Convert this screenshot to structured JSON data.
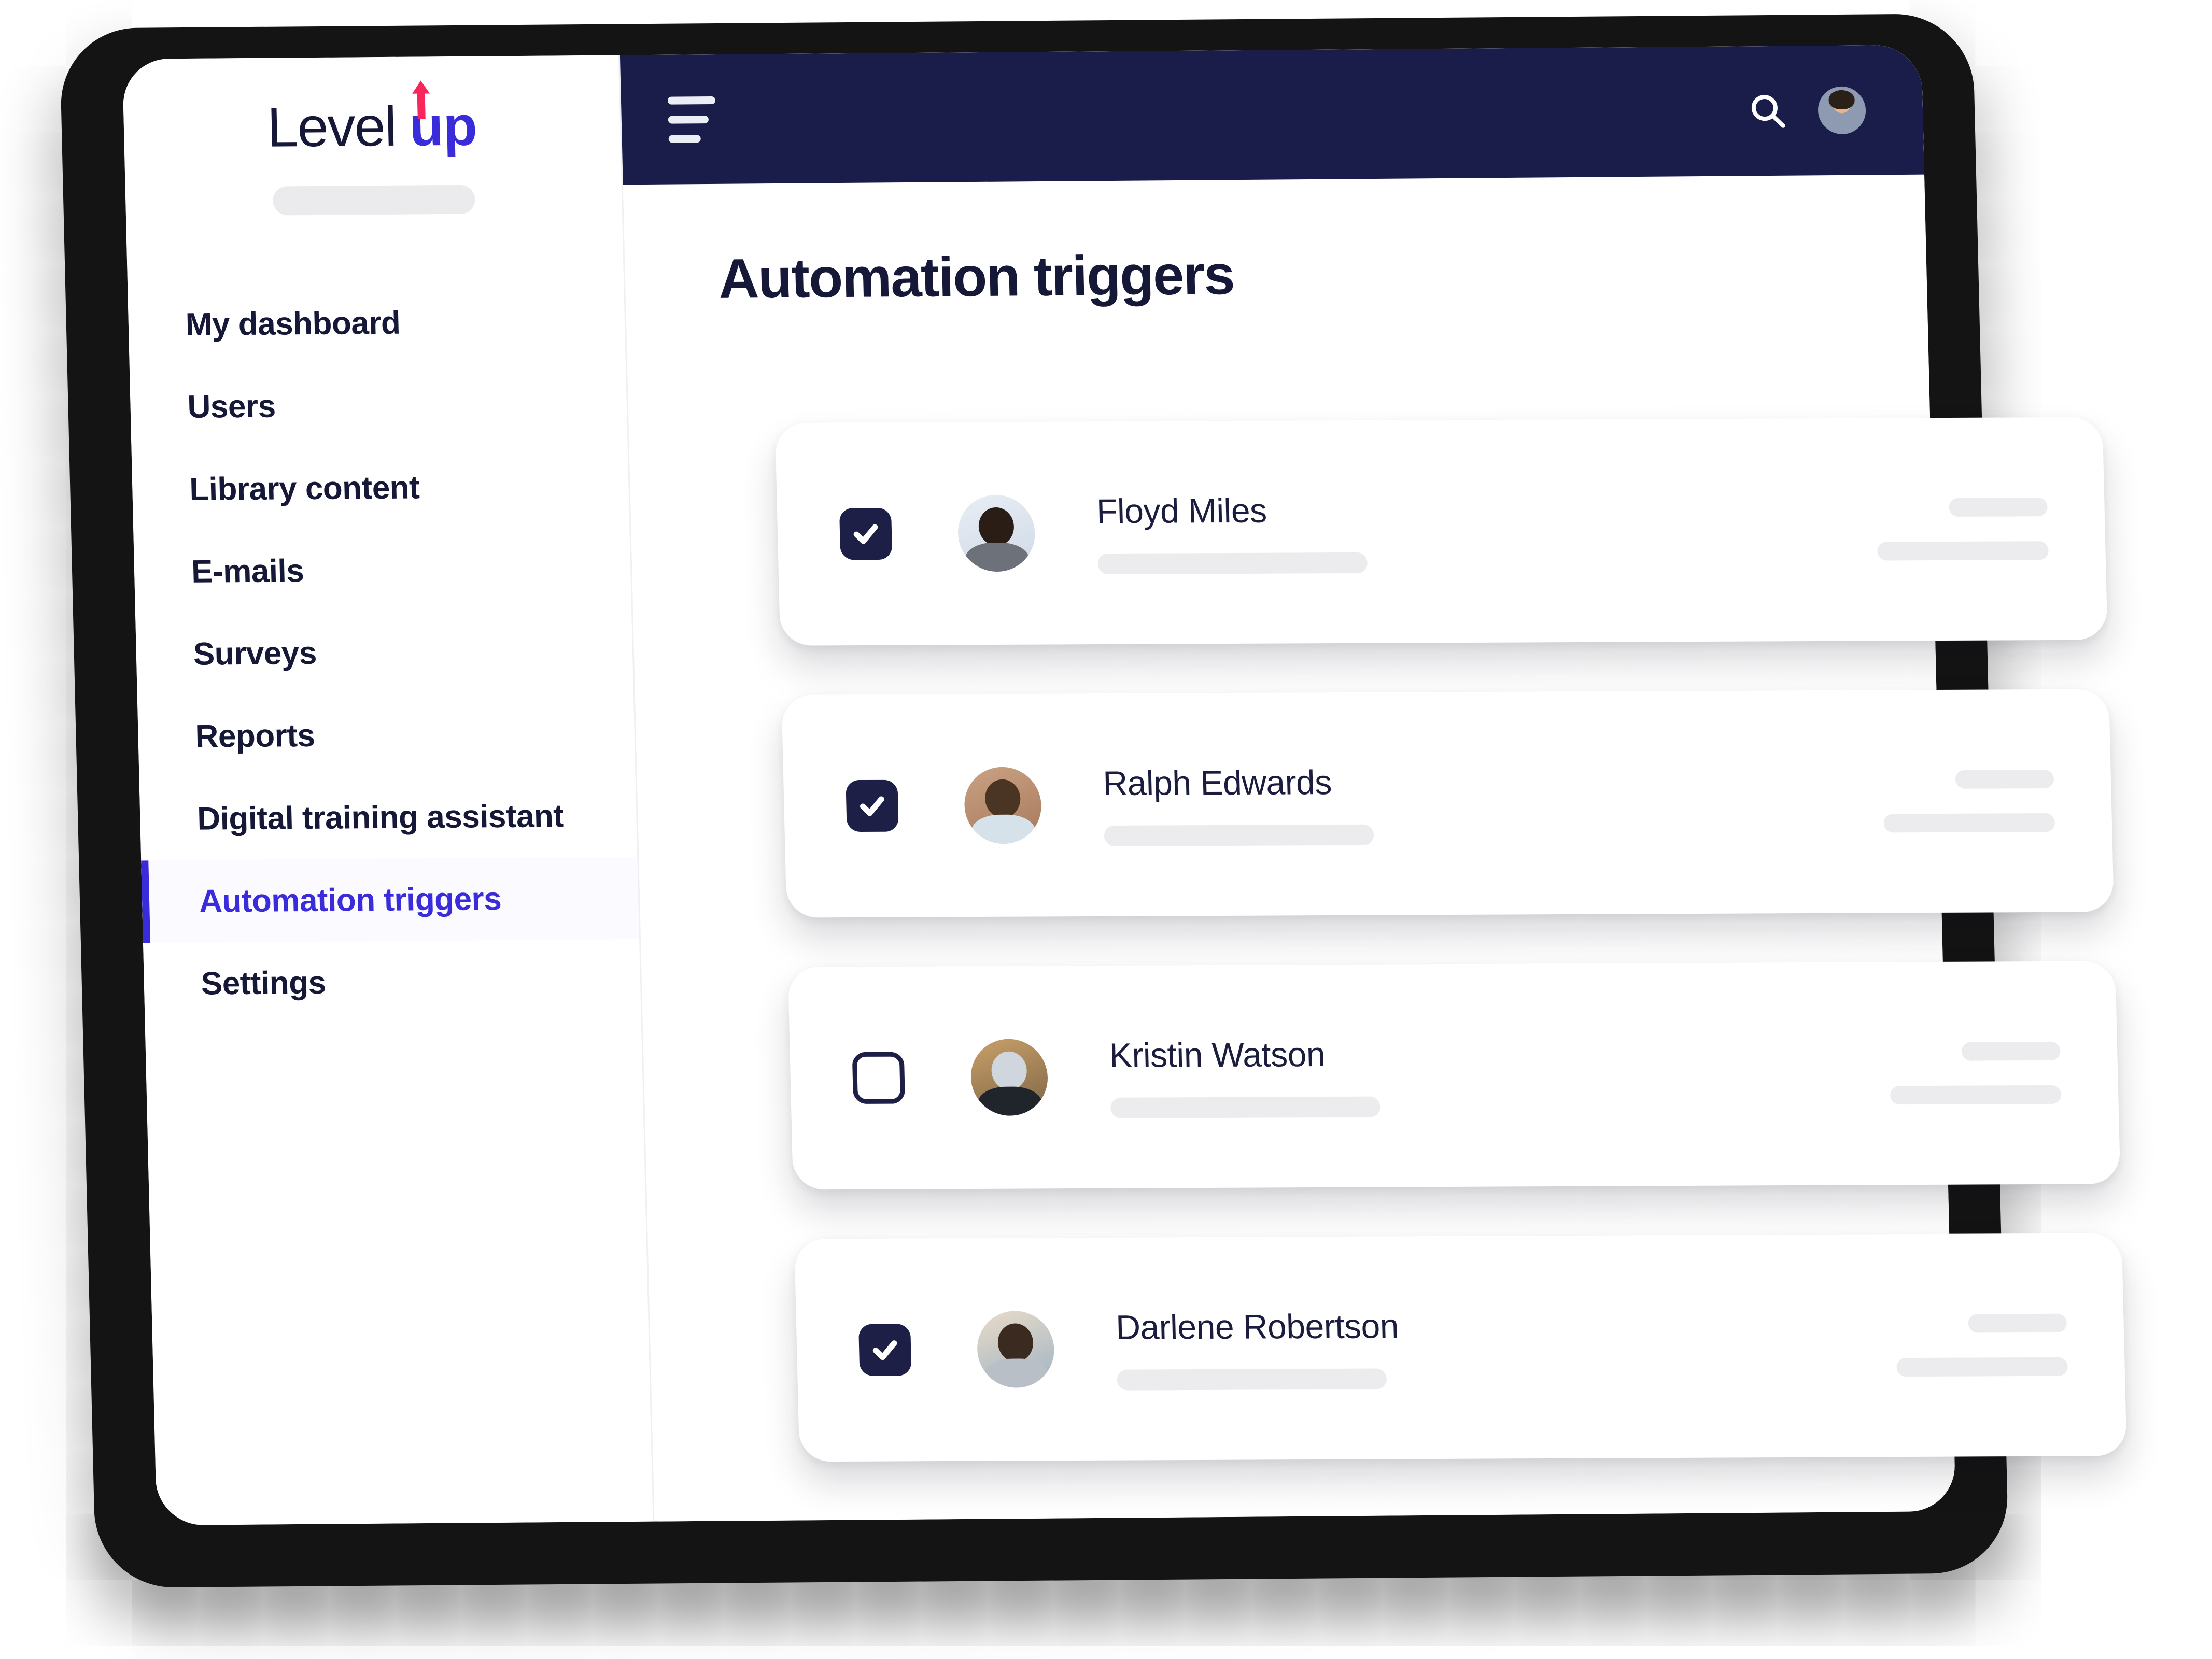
{
  "brand": {
    "logo_text_primary": "Level",
    "logo_text_accent": "up",
    "accent_color": "#3A2BDB",
    "arrow_color": "#F8265C",
    "navy_color": "#1A1C4A"
  },
  "sidebar": {
    "items": [
      {
        "label": "My dashboard",
        "active": false
      },
      {
        "label": "Users",
        "active": false
      },
      {
        "label": "Library content",
        "active": false
      },
      {
        "label": "E-mails",
        "active": false
      },
      {
        "label": "Surveys",
        "active": false
      },
      {
        "label": "Reports",
        "active": false
      },
      {
        "label": "Digital training assistant",
        "active": false
      },
      {
        "label": "Automation triggers",
        "active": true
      },
      {
        "label": "Settings",
        "active": false
      }
    ]
  },
  "topbar": {
    "menu_icon": "hamburger-icon",
    "search_icon": "search-icon",
    "avatar_icon": "user-avatar"
  },
  "main": {
    "page_title": "Automation triggers"
  },
  "list": {
    "rows": [
      {
        "name": "Floyd Miles",
        "checked": true,
        "avatar_icon": "avatar-floyd-miles"
      },
      {
        "name": "Ralph Edwards",
        "checked": true,
        "avatar_icon": "avatar-ralph-edwards"
      },
      {
        "name": "Kristin Watson",
        "checked": false,
        "avatar_icon": "avatar-kristin-watson"
      },
      {
        "name": "Darlene Robertson",
        "checked": true,
        "avatar_icon": "avatar-darlene-robertson"
      }
    ]
  }
}
